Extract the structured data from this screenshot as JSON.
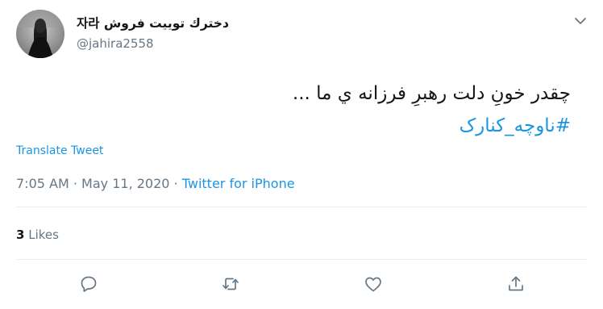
{
  "author": {
    "display_name": "자라 دخترك توييت فروش",
    "handle": "@jahira2558"
  },
  "tweet": {
    "text": "چقدر خونِ دلت رهبرِ فرزانه ي ما ...",
    "hashtag": "#ناوچه_کنارک"
  },
  "translate_label": "Translate Tweet",
  "meta": {
    "time": "7:05 AM",
    "date": "May 11, 2020",
    "separator": "·",
    "source": "Twitter for iPhone"
  },
  "likes": {
    "count": "3",
    "label": "Likes"
  },
  "icons": {
    "menu": "chevron-down-icon",
    "reply": "reply-icon",
    "retweet": "retweet-icon",
    "like": "heart-icon",
    "share": "share-icon"
  },
  "colors": {
    "link": "#1b95e0",
    "secondary_text": "#657786",
    "primary_text": "#14171a",
    "divider": "#e6ecf0"
  }
}
